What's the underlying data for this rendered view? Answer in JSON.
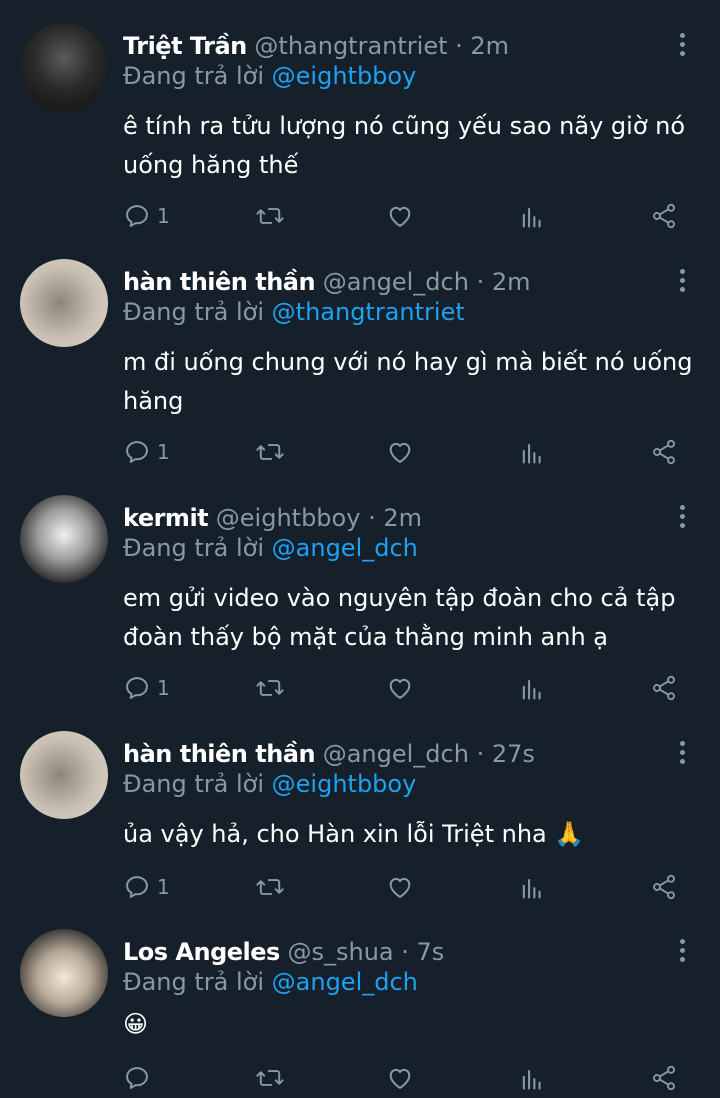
{
  "tweets": [
    {
      "name": "Triệt Trần",
      "handle": "@thangtrantriet",
      "time": "· 2m",
      "reply_prefix": "Đang trả lời",
      "reply_to": "@eightbboy",
      "text": "ê tính ra tửu lượng nó cũng yếu sao nãy giờ nó uống hăng thế",
      "reply_count": "1"
    },
    {
      "name": "hàn thiên thần",
      "handle": "@angel_dch",
      "time": "· 2m",
      "reply_prefix": "Đang trả lời",
      "reply_to": "@thangtrantriet",
      "text": "m đi uống chung với nó hay gì mà biết nó uống hăng",
      "reply_count": "1"
    },
    {
      "name": "kermit",
      "handle": "@eightbboy",
      "time": "· 2m",
      "reply_prefix": "Đang trả lời",
      "reply_to": "@angel_dch",
      "text": "em gửi video vào nguyên tập đoàn cho cả tập đoàn thấy bộ mặt của thằng minh anh ạ",
      "reply_count": "1"
    },
    {
      "name": "hàn thiên thần",
      "handle": "@angel_dch",
      "time": "· 27s",
      "reply_prefix": "Đang trả lời",
      "reply_to": "@eightbboy",
      "text": "ủa vậy hả, cho Hàn xin lỗi Triệt nha 🙏",
      "reply_count": "1"
    },
    {
      "name": "Los Angeles",
      "handle": "@s_shua",
      "time": "· 7s",
      "reply_prefix": "Đang trả lời",
      "reply_to": "@angel_dch",
      "text": "😀",
      "reply_count": ""
    }
  ],
  "colors": {
    "background": "#15202b",
    "text": "#ffffff",
    "muted": "#8899a6",
    "mention": "#1da1f2"
  },
  "icons": [
    "reply-icon",
    "retweet-icon",
    "like-icon",
    "analytics-icon",
    "share-icon",
    "more-icon"
  ]
}
